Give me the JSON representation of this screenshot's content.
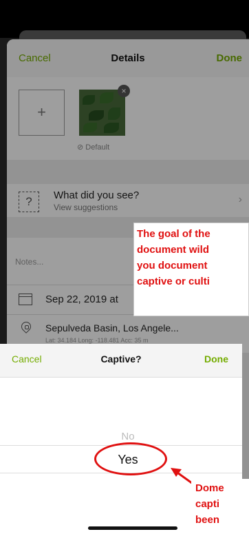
{
  "navbar": {
    "cancel": "Cancel",
    "title": "Details",
    "done": "Done"
  },
  "photo": {
    "add_symbol": "+",
    "remove_symbol": "×",
    "default_label": "⊘ Default"
  },
  "species": {
    "icon_text": "?",
    "title": "What did you see?",
    "subtitle": "View suggestions"
  },
  "notes": {
    "placeholder": "Notes..."
  },
  "date": {
    "text": "Sep 22, 2019 at"
  },
  "location": {
    "name": "Sepulveda Basin, Los Angele...",
    "coords": "Lat: 34.184  Long: -118.481  Acc: 35 m"
  },
  "picker": {
    "cancel": "Cancel",
    "title": "Captive?",
    "done": "Done",
    "option_no": "No",
    "option_yes": "Yes"
  },
  "chevron": "›",
  "callout_top": [
    "The goal of the",
    "document wild",
    "you document",
    "captive or culti"
  ],
  "callout_bottom": [
    "Dome",
    "capti",
    "been"
  ],
  "colors": {
    "accent": "#74ac00",
    "annotation": "#e01010"
  }
}
